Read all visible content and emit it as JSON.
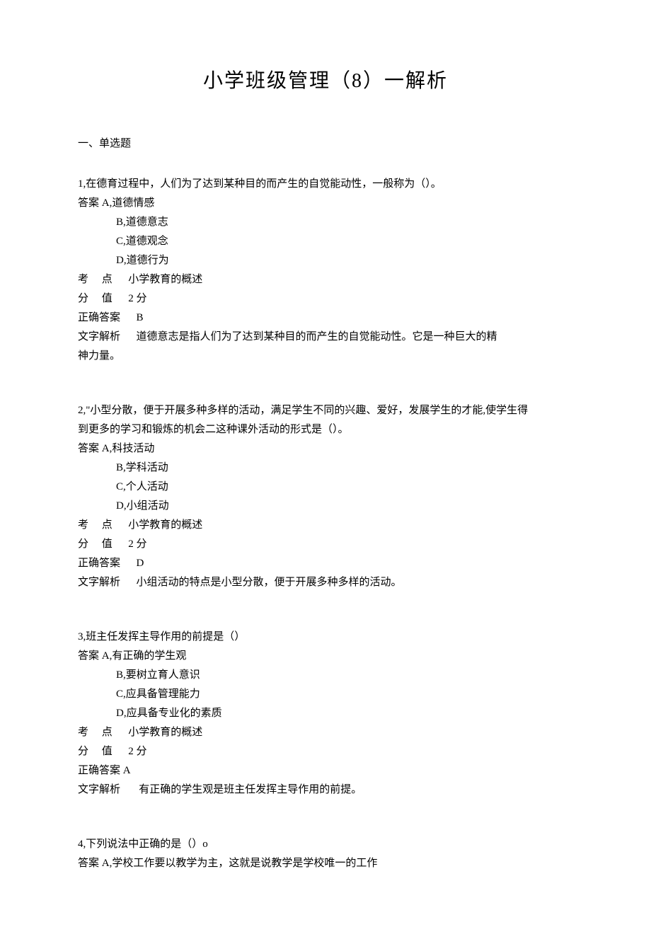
{
  "title": "小学班级管理（8）一解析",
  "section_header": "一、单选题",
  "questions": [
    {
      "number": "1",
      "stem": "在德育过程中，人们为了达到某种目的而产生的自觉能动性，一般称为（）。",
      "answer_letter": "答案 A,",
      "first_option": "道德情感",
      "options": [
        "B,道德意志",
        "C,道德观念",
        "D,道德行为"
      ],
      "meta": {
        "topic_label": "考     点",
        "topic_value": "小学教育的概述",
        "score_label": "分     值",
        "score_value": "2 分",
        "correct_label": "正确答案",
        "correct_value": "B",
        "explain_label": "文字解析",
        "explain_value": "道德意志是指人们为了达到某种目的而产生的自觉能动性。它是一种巨大的精",
        "explain_cont": "神力量。"
      }
    },
    {
      "number": "2",
      "stem_line1": "2,\"小型分散，便于开展多种多样的活动，满足学生不同的兴趣、爱好，发展学生的才能,使学生得",
      "stem_line2": "到更多的学习和锻炼的机会二这种课外活动的形式是（）。",
      "answer_letter": "答案 A,",
      "first_option": "科技活动",
      "options": [
        "B,学科活动",
        "C,个人活动",
        "D,小组活动"
      ],
      "meta": {
        "topic_label": "考     点",
        "topic_value": "小学教育的概述",
        "score_label": "分     值",
        "score_value": "2 分",
        "correct_label": "正确答案",
        "correct_value": "D",
        "explain_label": "文字解析",
        "explain_value": "小组活动的特点是小型分散，便于开展多种多样的活动。"
      }
    },
    {
      "number": "3",
      "stem": "班主任发挥主导作用的前提是（）",
      "answer_letter": "答案 A,",
      "first_option": "有正确的学生观",
      "options": [
        "B,要树立育人意识",
        "C,应具备管理能力",
        "D,应具备专业化的素质"
      ],
      "meta": {
        "topic_label": "考     点",
        "topic_value": "小学教育的概述",
        "score_label": "分     值",
        "score_value": "2 分",
        "correct_label": "正确答案 A",
        "correct_value": "",
        "explain_label": "文字解析",
        "explain_value": "有正确的学生观是班主任发挥主导作用的前提。"
      }
    },
    {
      "number": "4",
      "stem": "下列说法中正确的是（）o",
      "answer_letter": "答案 A,",
      "first_option": "学校工作要以教学为主，这就是说教学是学校唯一的工作"
    }
  ]
}
